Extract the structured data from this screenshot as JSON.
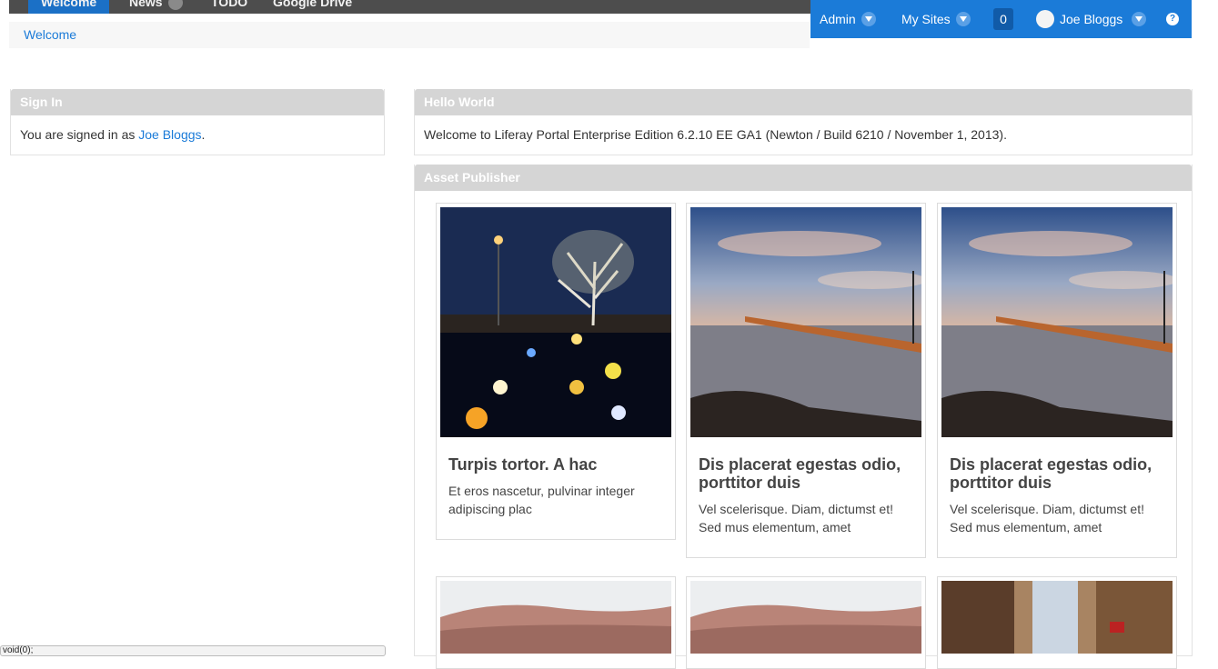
{
  "nav": {
    "tabs": [
      {
        "label": "Welcome"
      },
      {
        "label": "News"
      },
      {
        "label": "TODO"
      },
      {
        "label": "Google Drive"
      }
    ]
  },
  "dockbar": {
    "admin_label": "Admin",
    "my_sites_label": "My Sites",
    "notification_count": "0",
    "user_name": "Joe Bloggs",
    "help_label": "?",
    "color": "#1b7bd8"
  },
  "breadcrumb": {
    "current": "Welcome"
  },
  "sign_in": {
    "title": "Sign In",
    "text_prefix": "You are signed in as ",
    "user_link": "Joe Bloggs",
    "text_suffix": "."
  },
  "hello_world": {
    "title": "Hello World",
    "text": "Welcome to Liferay Portal Enterprise Edition 6.2.10 EE GA1 (Newton / Build 6210 / November 1, 2013)."
  },
  "asset_publisher": {
    "title": "Asset Publisher",
    "cards": [
      {
        "title": "Turpis tortor. A hac",
        "summary": "Et eros nascetur, pulvinar integer adipiscing plac",
        "image": "night-tree-lights-image"
      },
      {
        "title": "Dis placerat egestas odio, porttitor duis",
        "summary": "Vel scelerisque. Diam, dictumst et! Sed mus elementum, amet",
        "image": "pier-sunset-image"
      },
      {
        "title": "Dis placerat egestas odio, porttitor duis",
        "summary": "Vel scelerisque. Diam, dictumst et! Sed mus elementum, amet",
        "image": "pier-sunset-image"
      }
    ],
    "row2_images": [
      "red-rock-image",
      "red-rock-image",
      "city-street-image"
    ]
  },
  "status_bar": {
    "text": "void(0);"
  }
}
